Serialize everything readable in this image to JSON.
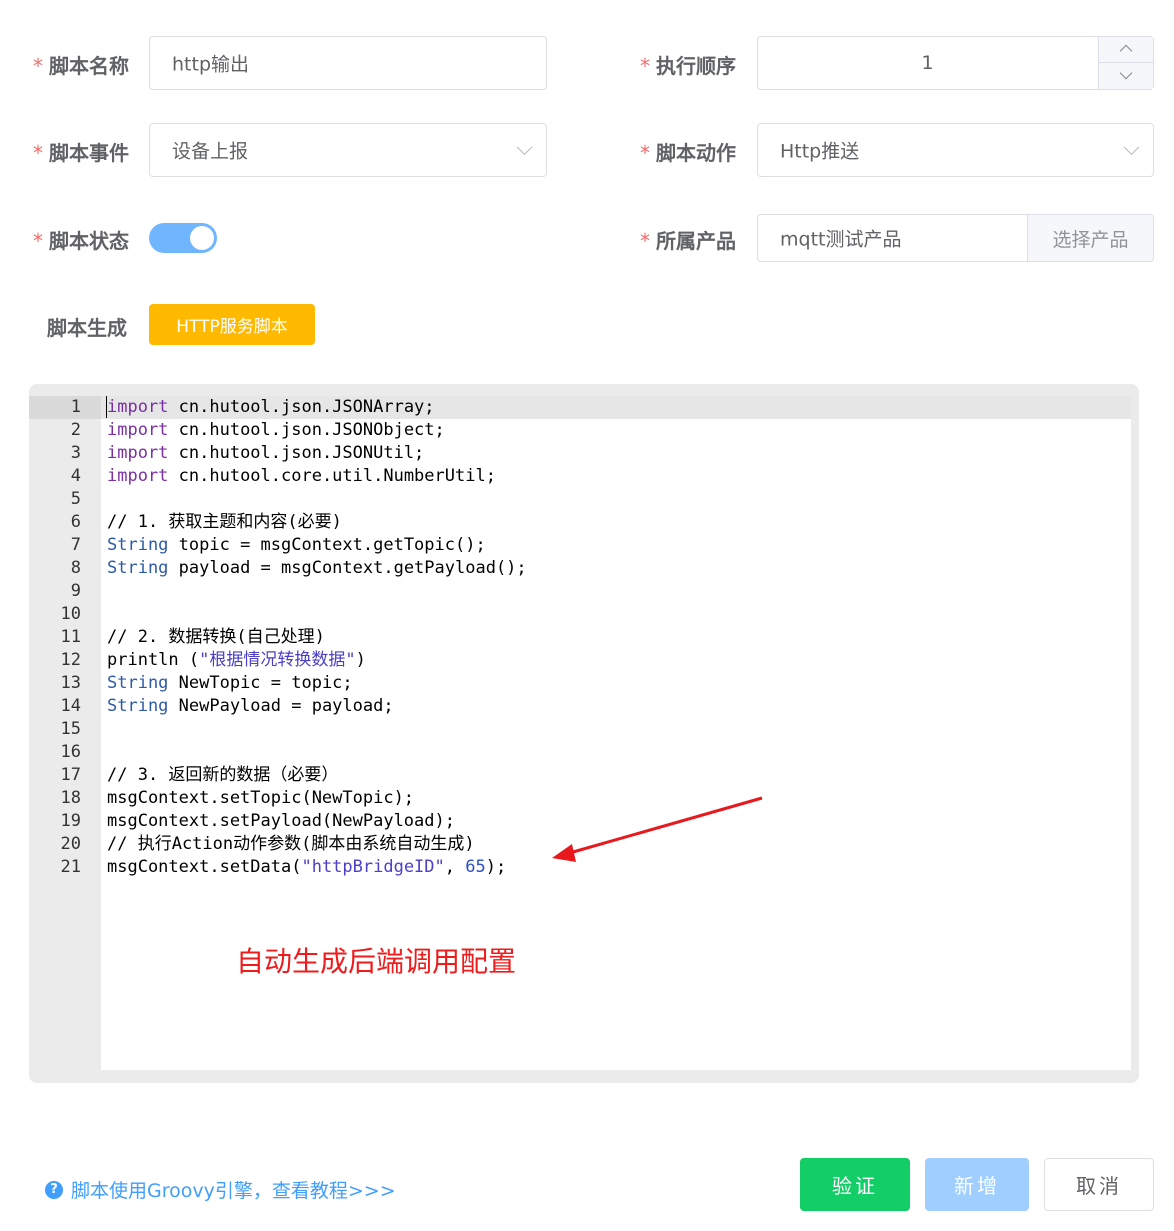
{
  "form": {
    "script_name": {
      "label": "脚本名称",
      "required": true,
      "value": "http输出"
    },
    "exec_order": {
      "label": "执行顺序",
      "required": true,
      "value": "1"
    },
    "script_event": {
      "label": "脚本事件",
      "required": true,
      "value": "设备上报"
    },
    "script_action": {
      "label": "脚本动作",
      "required": true,
      "value": "Http推送"
    },
    "script_status": {
      "label": "脚本状态",
      "required": true,
      "enabled": true
    },
    "product": {
      "label": "所属产品",
      "required": true,
      "value": "mqtt测试产品",
      "button": "选择产品"
    },
    "script_gen": {
      "label": "脚本生成",
      "button": "HTTP服务脚本"
    },
    "required_mark": "*"
  },
  "editor": {
    "lines": [
      "1",
      "2",
      "3",
      "4",
      "5",
      "6",
      "7",
      "8",
      "9",
      "10",
      "11",
      "12",
      "13",
      "14",
      "15",
      "16",
      "17",
      "18",
      "19",
      "20",
      "21"
    ],
    "code": {
      "l1_kw": "import",
      "l1_rest": " cn.hutool.json.JSONArray;",
      "l2_kw": "import",
      "l2_rest": " cn.hutool.json.JSONObject;",
      "l3_kw": "import",
      "l3_rest": " cn.hutool.json.JSONUtil;",
      "l4_kw": "import",
      "l4_rest": " cn.hutool.core.util.NumberUtil;",
      "l6": "// 1. 获取主题和内容(必要)",
      "l7_ty": "String",
      "l7_rest": " topic = msgContext.getTopic();",
      "l8_ty": "String",
      "l8_rest": " payload = msgContext.getPayload();",
      "l11": "// 2. 数据转换(自己处理)",
      "l12_a": "println (",
      "l12_str": "\"根据情况转换数据\"",
      "l12_b": ")",
      "l13_ty": "String",
      "l13_rest": " NewTopic = topic;",
      "l14_ty": "String",
      "l14_rest": " NewPayload = payload;",
      "l17": "// 3. 返回新的数据（必要）",
      "l18": "msgContext.setTopic(NewTopic);",
      "l19": "msgContext.setPayload(NewPayload);",
      "l20": "// 执行Action动作参数(脚本由系统自动生成)",
      "l21_a": "msgContext.setData(",
      "l21_str": "\"httpBridgeID\"",
      "l21_b": ", ",
      "l21_num": "65",
      "l21_c": ");"
    }
  },
  "annotation": {
    "text": "自动生成后端调用配置",
    "color": "#ee1c1c"
  },
  "footer": {
    "help_icon": "?",
    "help_text": "脚本使用Groovy引擎，查看教程>>>",
    "verify": "验证",
    "add": "新增",
    "cancel": "取消"
  },
  "colors": {
    "primary": "#409eff",
    "success": "#13ce66",
    "warning": "#ffba00",
    "required": "#f56c6c"
  }
}
